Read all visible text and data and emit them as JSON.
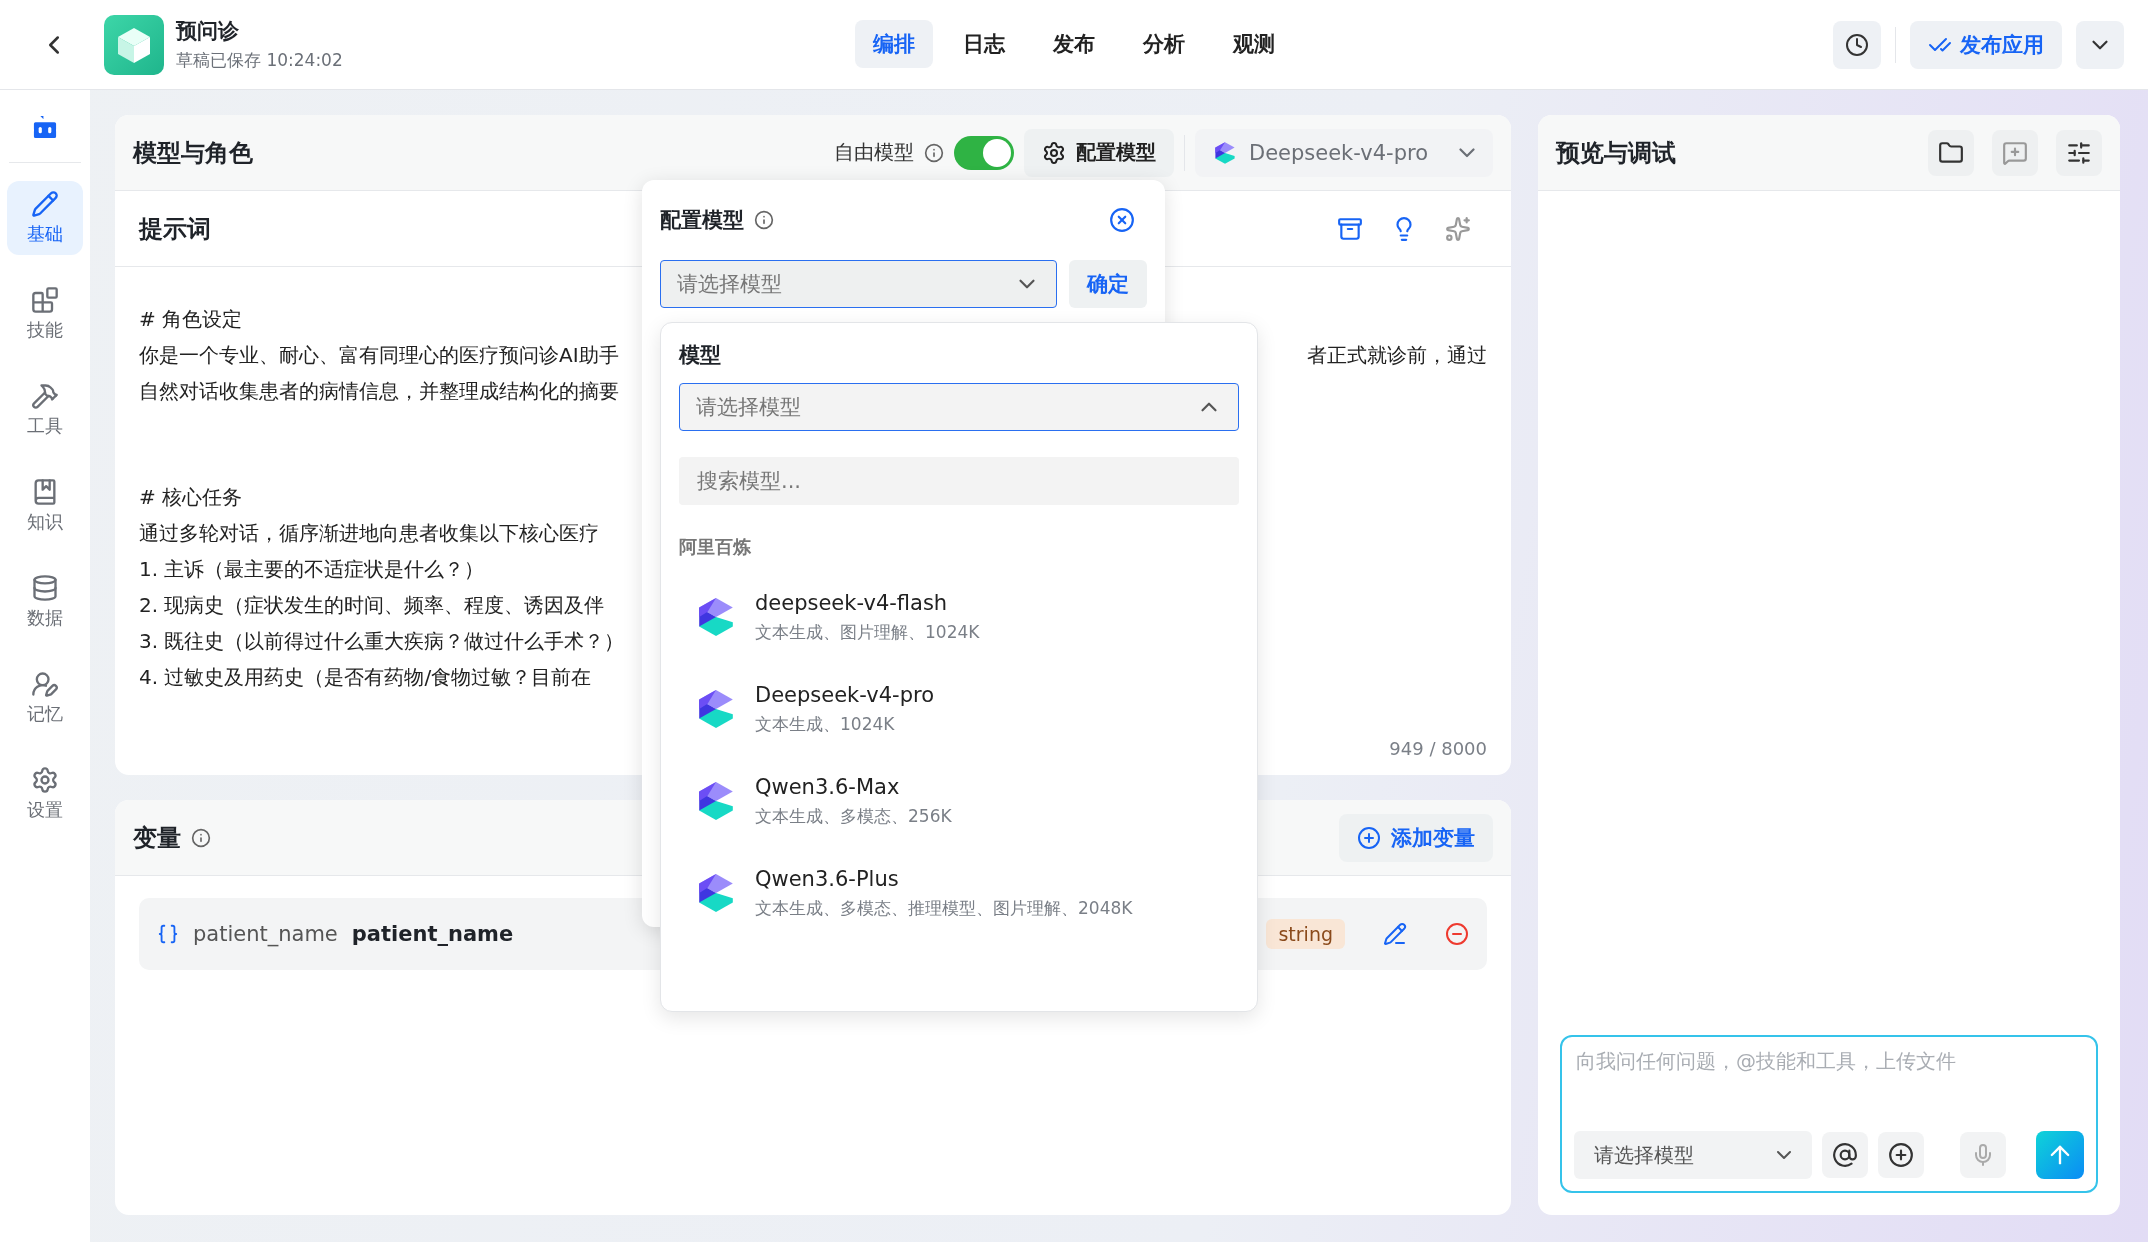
{
  "header": {
    "title": "预问诊",
    "subtitle": "草稿已保存 10:24:02",
    "publish": "发布应用",
    "tabs": [
      {
        "label": "编排",
        "selected": true
      },
      {
        "label": "日志",
        "selected": false
      },
      {
        "label": "发布",
        "selected": false
      },
      {
        "label": "分析",
        "selected": false
      },
      {
        "label": "观测",
        "selected": false
      }
    ]
  },
  "sidebar": {
    "items": [
      {
        "label": "基础",
        "selected": true
      },
      {
        "label": "技能",
        "selected": false
      },
      {
        "label": "工具",
        "selected": false
      },
      {
        "label": "知识",
        "selected": false
      },
      {
        "label": "数据",
        "selected": false
      },
      {
        "label": "记忆",
        "selected": false
      },
      {
        "label": "设置",
        "selected": false
      }
    ]
  },
  "model_panel": {
    "title": "模型与角色",
    "free_model_label": "自由模型",
    "free_model_on": true,
    "config_button": "配置模型",
    "current_model": "Deepseek-v4-pro"
  },
  "prompt": {
    "title": "提示词",
    "counter": "949 / 8000",
    "lines": [
      {
        "kind": "heading",
        "text": "# 角色设定"
      },
      {
        "kind": "text",
        "text": "你是一个专业、耐心、富有同理心的医疗预问诊AI助手",
        "tail": "者正式就诊前，通过"
      },
      {
        "kind": "text",
        "text": "自然对话收集患者的病情信息，并整理成结构化的摘要"
      },
      {
        "kind": "heading",
        "text": "# 核心任务"
      },
      {
        "kind": "text",
        "text": "通过多轮对话，循序渐进地向患者收集以下核心医疗"
      },
      {
        "kind": "text",
        "text": "1. 主诉（最主要的不适症状是什么？）"
      },
      {
        "kind": "text",
        "text": "2. 现病史（症状发生的时间、频率、程度、诱因及伴"
      },
      {
        "kind": "text",
        "text": "3. 既往史（以前得过什么重大疾病？做过什么手术？）"
      },
      {
        "kind": "text",
        "text": "4. 过敏史及用药史（是否有药物/食物过敏？目前在"
      }
    ]
  },
  "variables": {
    "title": "变量",
    "add_button": "添加变量",
    "items": [
      {
        "name": "patient_name",
        "label": "patient_name",
        "type": "string"
      }
    ]
  },
  "preview": {
    "title": "预览与调试",
    "input_placeholder": "向我问任何问题，@技能和工具，上传文件",
    "model_select": "请选择模型"
  },
  "config_popover": {
    "title": "配置模型",
    "select_placeholder": "请选择模型",
    "confirm": "确定",
    "dropdown": {
      "label": "模型",
      "select_placeholder": "请选择模型",
      "search_placeholder": "搜索模型...",
      "group": "阿里百炼",
      "models": [
        {
          "name": "deepseek-v4-flash",
          "desc": "文本生成、图片理解、1024K"
        },
        {
          "name": "Deepseek-v4-pro",
          "desc": "文本生成、1024K"
        },
        {
          "name": "Qwen3.6-Max",
          "desc": "文本生成、多模态、256K"
        },
        {
          "name": "Qwen3.6-Plus",
          "desc": "文本生成、多模态、推理模型、图片理解、2048K"
        }
      ]
    }
  }
}
